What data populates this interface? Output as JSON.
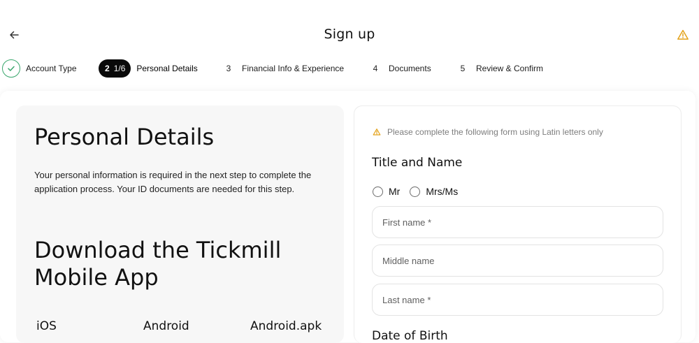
{
  "header": {
    "title": "Sign up",
    "back_icon": "arrow-left-icon",
    "warning_icon": "warning-triangle-icon",
    "warning_color": "#e3a21a"
  },
  "stepper": {
    "steps": [
      {
        "number": "1",
        "label": "Account Type",
        "status": "done"
      },
      {
        "number": "2",
        "progress": "1/6",
        "label": "Personal Details",
        "status": "active"
      },
      {
        "number": "3",
        "label": "Financial Info & Experience",
        "status": "pending"
      },
      {
        "number": "4",
        "label": "Documents",
        "status": "pending"
      },
      {
        "number": "5",
        "label": "Review & Confirm",
        "status": "pending"
      }
    ],
    "done_color": "#3aa76d",
    "active_color": "#0a0a0a"
  },
  "left": {
    "title": "Personal Details",
    "description": "Your personal information is required in the next step to complete the application process. Your ID documents are needed for this step.",
    "download_title": "Download the Tickmill Mobile App",
    "platforms": [
      "iOS",
      "Android",
      "Android.apk"
    ]
  },
  "form": {
    "notice": "Please complete the following form using Latin letters only",
    "title_section": "Title and Name",
    "title_options": [
      "Mr",
      "Mrs/Ms"
    ],
    "first_name_placeholder": "First name *",
    "middle_name_placeholder": "Middle name",
    "last_name_placeholder": "Last name *",
    "dob_section": "Date of Birth"
  }
}
